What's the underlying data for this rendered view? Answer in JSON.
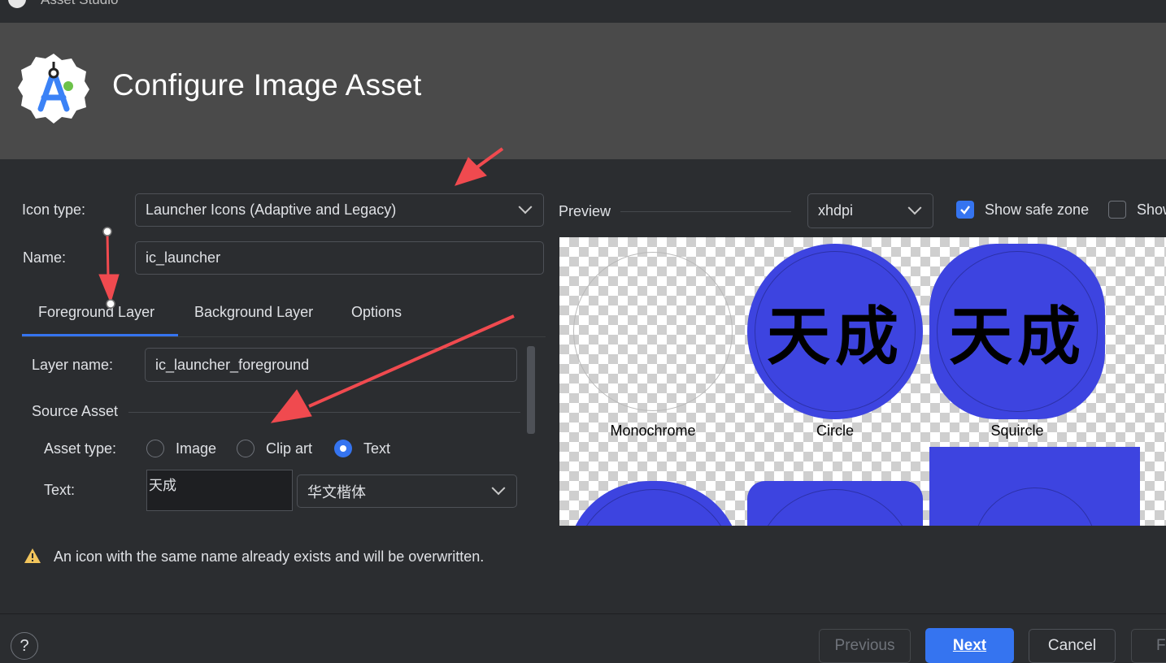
{
  "window": {
    "title": "Asset Studio"
  },
  "header": {
    "title": "Configure Image Asset",
    "logo_icon": "android-studio-logo-icon"
  },
  "form": {
    "icon_type_label": "Icon type:",
    "icon_type_value": "Launcher Icons (Adaptive and Legacy)",
    "name_label": "Name:",
    "name_value": "ic_launcher"
  },
  "tabs": [
    {
      "label": "Foreground Layer",
      "selected": true
    },
    {
      "label": "Background Layer",
      "selected": false
    },
    {
      "label": "Options",
      "selected": false
    }
  ],
  "layer": {
    "layer_name_label": "Layer name:",
    "layer_name_value": "ic_launcher_foreground",
    "source_asset_label": "Source Asset",
    "asset_type_label": "Asset type:",
    "asset_types": [
      {
        "label": "Image",
        "selected": false
      },
      {
        "label": "Clip art",
        "selected": false
      },
      {
        "label": "Text",
        "selected": true
      }
    ],
    "text_label": "Text:",
    "text_value": "天成",
    "font_value": "华文楷体"
  },
  "preview": {
    "label": "Preview",
    "density_value": "xhdpi",
    "show_safe_zone_label": "Show safe zone",
    "show_safe_zone_checked": true,
    "show_grid_label": "Show",
    "show_grid_checked": false,
    "glyph_text": "天成",
    "shape_color": "#3d44e0",
    "shapes": [
      {
        "label": "Monochrome"
      },
      {
        "label": "Circle"
      },
      {
        "label": "Squircle"
      }
    ]
  },
  "warning": {
    "text": "An icon with the same name already exists and will be overwritten.",
    "icon": "warning-icon"
  },
  "footer": {
    "help_label": "?",
    "previous_label": "Previous",
    "next_label": "Next",
    "cancel_label": "Cancel",
    "finish_label": "Fi"
  },
  "annotation_color": "#f04a4f"
}
